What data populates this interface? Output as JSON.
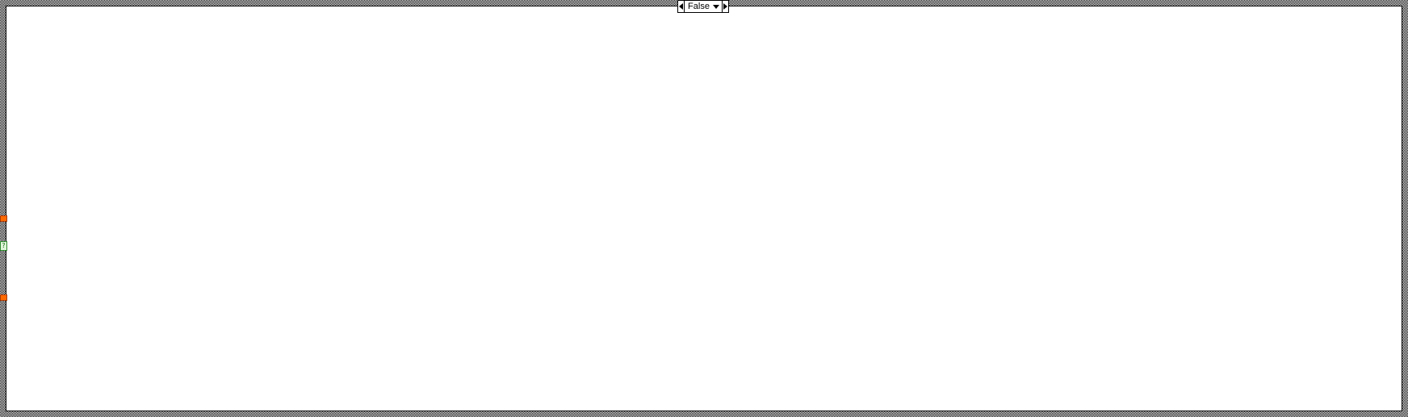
{
  "case_structure": {
    "selector": {
      "value": "False"
    },
    "selector_terminal": {
      "glyph": "?",
      "color": "#2e8b2e"
    },
    "tunnels": [
      {
        "name": "input-tunnel-1",
        "color": "#ff6a00"
      },
      {
        "name": "input-tunnel-2",
        "color": "#ff6a00"
      }
    ]
  }
}
